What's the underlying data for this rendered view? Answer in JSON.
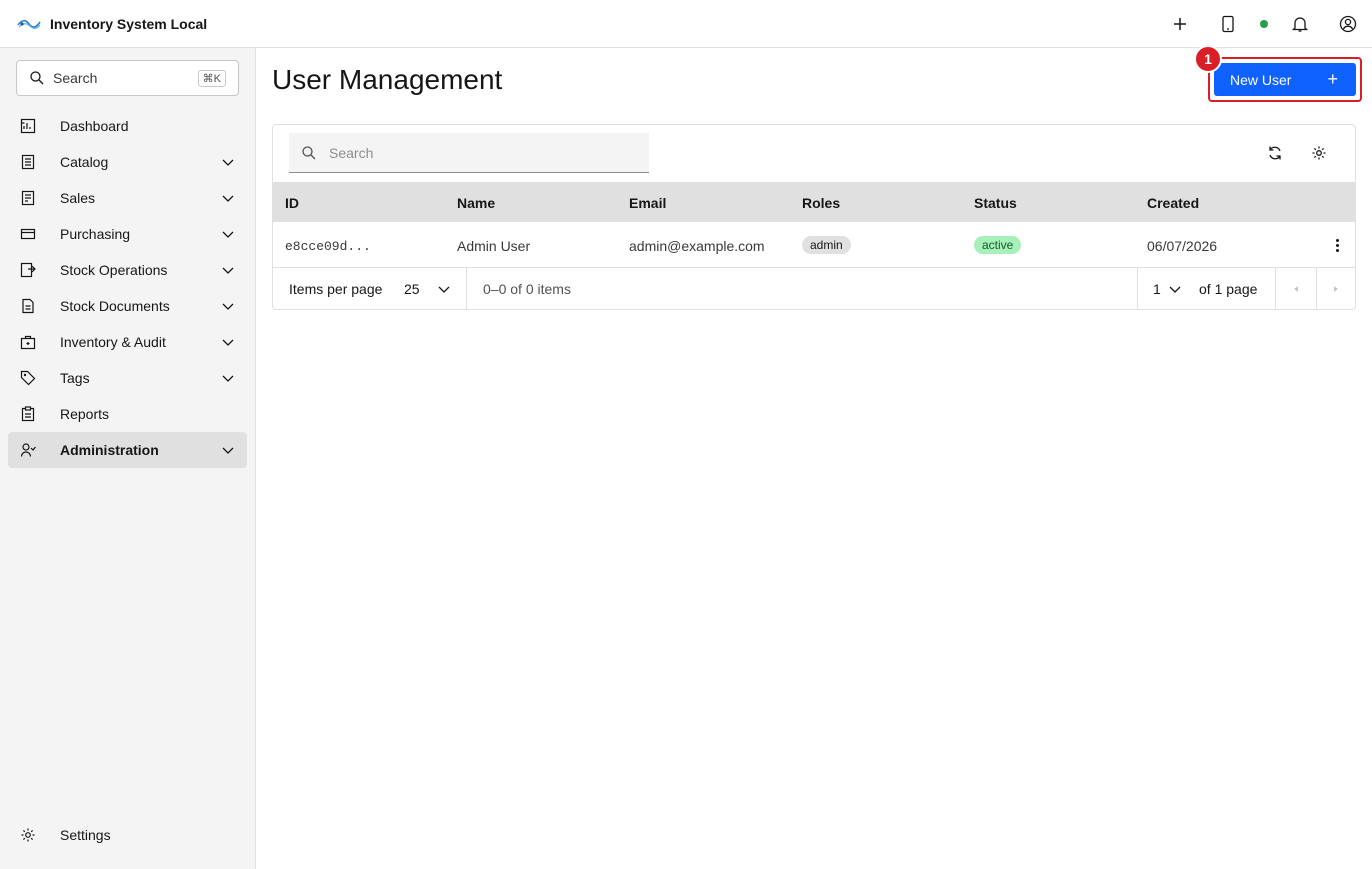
{
  "app": {
    "title": "Inventory System Local"
  },
  "header": {
    "actions": [
      "add-icon",
      "tablet-icon",
      "status-dot",
      "notification-icon",
      "user-avatar-icon"
    ],
    "status_color": "#24a148"
  },
  "sidebar": {
    "search_label": "Search",
    "search_shortcut": "⌘K",
    "items": [
      {
        "label": "Dashboard",
        "icon": "dashboard-icon",
        "expandable": false
      },
      {
        "label": "Catalog",
        "icon": "catalog-icon",
        "expandable": true
      },
      {
        "label": "Sales",
        "icon": "sales-icon",
        "expandable": true
      },
      {
        "label": "Purchasing",
        "icon": "purchasing-icon",
        "expandable": true
      },
      {
        "label": "Stock Operations",
        "icon": "stock-operations-icon",
        "expandable": true
      },
      {
        "label": "Stock Documents",
        "icon": "stock-documents-icon",
        "expandable": true
      },
      {
        "label": "Inventory & Audit",
        "icon": "inventory-audit-icon",
        "expandable": true
      },
      {
        "label": "Tags",
        "icon": "tag-icon",
        "expandable": true
      },
      {
        "label": "Reports",
        "icon": "reports-icon",
        "expandable": false
      },
      {
        "label": "Administration",
        "icon": "administration-icon",
        "expandable": true,
        "active": true
      }
    ],
    "settings_label": "Settings"
  },
  "main": {
    "page_title": "User Management",
    "new_user_label": "New User",
    "new_user_plus": "+",
    "annotation_number": "1",
    "accent_color": "#0f62fe",
    "highlight_color": "#da1e28",
    "table": {
      "search_placeholder": "Search",
      "columns": [
        "ID",
        "Name",
        "Email",
        "Roles",
        "Status",
        "Created"
      ],
      "rows": [
        {
          "id": "e8cce09d...",
          "name": "Admin User",
          "email": "admin@example.com",
          "role": "admin",
          "status": "active",
          "created": "06/07/2026"
        }
      ],
      "pagination": {
        "items_per_page_label": "Items per page",
        "items_per_page_value": "25",
        "range_text": "0–0 of 0 items",
        "current_page": "1",
        "page_total_text": "of 1 page"
      }
    }
  }
}
